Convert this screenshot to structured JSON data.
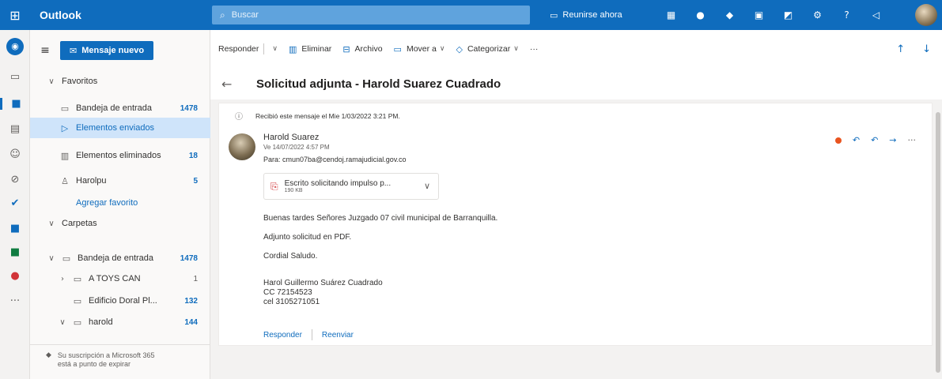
{
  "topbar": {
    "app_name": "Outlook",
    "search_placeholder": "Buscar",
    "meet_label": "Reunirse ahora"
  },
  "folders": {
    "new_message_label": "Mensaje nuevo",
    "favorites_header": "Favoritos",
    "favorites": [
      {
        "label": "Bandeja de entrada",
        "count": "1478"
      },
      {
        "label": "Elementos enviados",
        "count": ""
      },
      {
        "label": "Elementos eliminados",
        "count": "18"
      },
      {
        "label": "Harolpu",
        "count": "5"
      }
    ],
    "add_favorite": "Agregar favorito",
    "folders_header": "Carpetas",
    "tree": [
      {
        "label": "Bandeja de entrada",
        "count": "1478"
      },
      {
        "label": "A TOYS CAN",
        "count": "1"
      },
      {
        "label": "Edificio Doral Pl...",
        "count": "132"
      },
      {
        "label": "harold",
        "count": "144"
      }
    ],
    "subscription_notice": "Su suscripción a Microsoft 365 está a punto de expirar"
  },
  "command_bar": {
    "reply": "Responder",
    "delete": "Eliminar",
    "archive": "Archivo",
    "move": "Mover a",
    "categorize": "Categorizar",
    "more": "···"
  },
  "message": {
    "subject": "Solicitud adjunta - Harold Suarez Cuadrado",
    "notice": "Recibió este mensaje el Mie 1/03/2022 3:21 PM.",
    "sender_name": "Harold Suarez",
    "sent_date": "Ve 14/07/2022 4:57 PM",
    "to_line": "Para: cmun07ba@cendoj.ramajudicial.gov.co",
    "attachment": {
      "name": "Escrito solicitando impulso p...",
      "size": "190 KB"
    },
    "body": [
      "Buenas tardes Señores Juzgado 07 civil municipal de Barranquilla.",
      "Adjunto solicitud en PDF.",
      "Cordial Saludo.",
      "Harol Guillermo Suárez Cuadrado",
      "CC 72154523",
      "cel 3105271051"
    ],
    "reply_link": "Responder",
    "forward_link": "Reenviar"
  }
}
